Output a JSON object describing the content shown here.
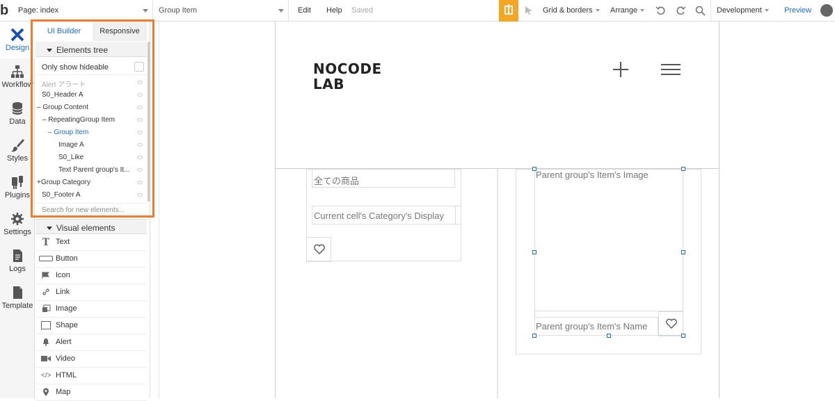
{
  "topbar": {
    "logo": "b",
    "page_label": "Page: index",
    "group_label": "Group Item",
    "edit": "Edit",
    "help": "Help",
    "saved": "Saved",
    "grid": "Grid & borders",
    "arrange": "Arrange",
    "environment": "Development",
    "preview": "Preview"
  },
  "leftnav": {
    "items": [
      {
        "label": "Design",
        "icon": "design-icon"
      },
      {
        "label": "Workflow",
        "icon": "workflow-icon"
      },
      {
        "label": "Data",
        "icon": "database-icon"
      },
      {
        "label": "Styles",
        "icon": "brush-icon"
      },
      {
        "label": "Plugins",
        "icon": "plug-icon"
      },
      {
        "label": "Settings",
        "icon": "gear-icon"
      },
      {
        "label": "Logs",
        "icon": "document-icon"
      },
      {
        "label": "Template",
        "icon": "template-icon"
      }
    ]
  },
  "panel": {
    "tabs": {
      "ui": "UI Builder",
      "responsive": "Responsive"
    },
    "elements_tree": "Elements tree",
    "only_show": "Only show hideable",
    "tree": [
      {
        "label": "Alert アラート"
      },
      {
        "label": "S0_Header A"
      },
      {
        "label": "Group Content"
      },
      {
        "label": "RepeatingGroup Item"
      },
      {
        "label": "Group Item"
      },
      {
        "label": "Image A"
      },
      {
        "label": "S0_Like"
      },
      {
        "label": "Text Parent group's It..."
      },
      {
        "label": "Group Category"
      },
      {
        "label": "S0_Footer A"
      }
    ],
    "search_placeholder": "Search for new elements...",
    "visual_elements": "Visual elements",
    "visual": [
      {
        "label": "Text",
        "icon": "text-icon"
      },
      {
        "label": "Button",
        "icon": "button-icon"
      },
      {
        "label": "Icon",
        "icon": "flag-icon"
      },
      {
        "label": "Link",
        "icon": "link-icon"
      },
      {
        "label": "Image",
        "icon": "image-icon"
      },
      {
        "label": "Shape",
        "icon": "shape-icon"
      },
      {
        "label": "Alert",
        "icon": "bell-icon"
      },
      {
        "label": "Video",
        "icon": "video-icon"
      },
      {
        "label": "HTML",
        "icon": "code-icon"
      },
      {
        "label": "Map",
        "icon": "map-pin-icon"
      }
    ]
  },
  "canvas": {
    "brand_line1": "NOCODE",
    "brand_line2": "LAB",
    "all_products": "全ての商品",
    "category_display": "Current cell's Category's Display",
    "item_image": "Parent group's Item's Image",
    "item_name": "Parent group's Item's Name"
  }
}
